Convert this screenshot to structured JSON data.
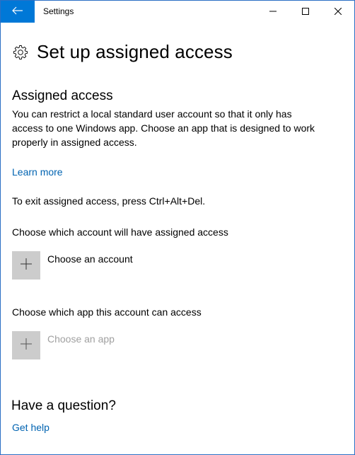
{
  "window": {
    "title": "Settings",
    "accent_color": "#0078d7",
    "icons": {
      "back": "back-arrow-icon",
      "minimize": "minimize-icon",
      "maximize": "maximize-icon",
      "close": "close-icon"
    }
  },
  "header": {
    "icon": "gear-icon",
    "title": "Set up assigned access"
  },
  "assigned_access": {
    "title": "Assigned access",
    "description": "You can restrict a local standard user account so that it only has access to one Windows app. Choose an app that is designed to work properly in assigned access.",
    "learn_more": "Learn more",
    "exit_instructions": "To exit assigned access, press Ctrl+Alt+Del."
  },
  "account_picker": {
    "label": "Choose which account will have assigned access",
    "button_label": "Choose an account",
    "icon": "plus-icon"
  },
  "app_picker": {
    "label": "Choose which app this account can access",
    "button_label": "Choose an app",
    "icon": "plus-icon",
    "disabled": true
  },
  "help": {
    "title": "Have a question?",
    "link": "Get help"
  },
  "colors": {
    "link": "#0063b1",
    "tile": "#cccccc",
    "disabled_text": "#a0a0a0"
  }
}
